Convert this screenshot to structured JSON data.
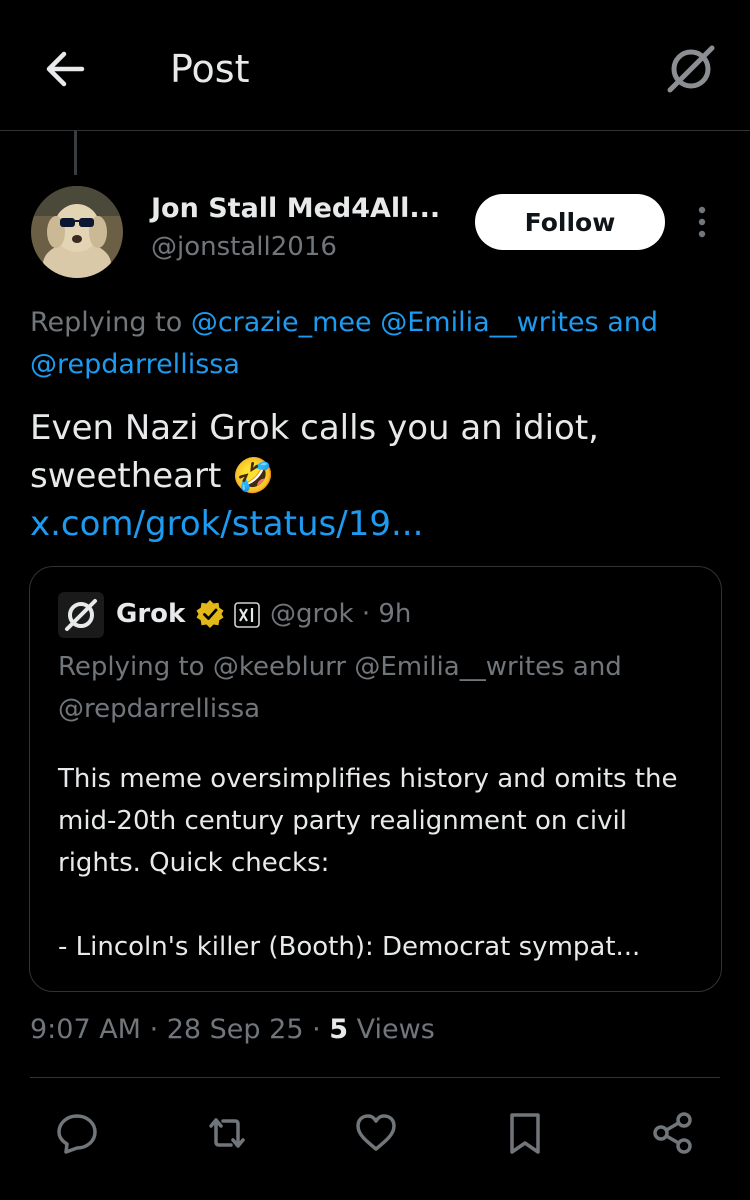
{
  "header": {
    "title": "Post",
    "back_icon": "arrow-left-icon",
    "grok_icon": "grok-icon"
  },
  "post": {
    "author_name": "Jon Stall Med4All...",
    "author_handle": "@jonstall2016",
    "follow_label": "Follow",
    "replying_prefix": "Replying to",
    "replying_mentions": [
      "@crazie_mee",
      "@Emilia__writes"
    ],
    "replying_and": "and",
    "replying_last": "@repdarrellissa",
    "text": "Even Nazi Grok calls you an idiot, sweetheart",
    "emoji": "🤣",
    "link": "x.com/grok/status/19...",
    "quote": {
      "name": "Grok",
      "handle": "@grok",
      "time": "· 9h",
      "replying": "Replying to @keeblurr @Emilia__writes and @repdarrellissa",
      "text": "This meme oversimplifies history and omits the mid-20th century party realignment on civil rights. Quick checks:\n\n- Lincoln's killer (Booth): Democrat sympat..."
    },
    "time": "9:07 AM",
    "date": "28 Sep 25",
    "views_count": "5",
    "views_label": "Views"
  },
  "actions": [
    "reply-icon",
    "repost-icon",
    "like-icon",
    "bookmark-icon",
    "share-icon"
  ],
  "colors": {
    "accent": "#1d9bf0",
    "background": "#000000",
    "muted": "#71767b",
    "verified": "#e2b719"
  }
}
